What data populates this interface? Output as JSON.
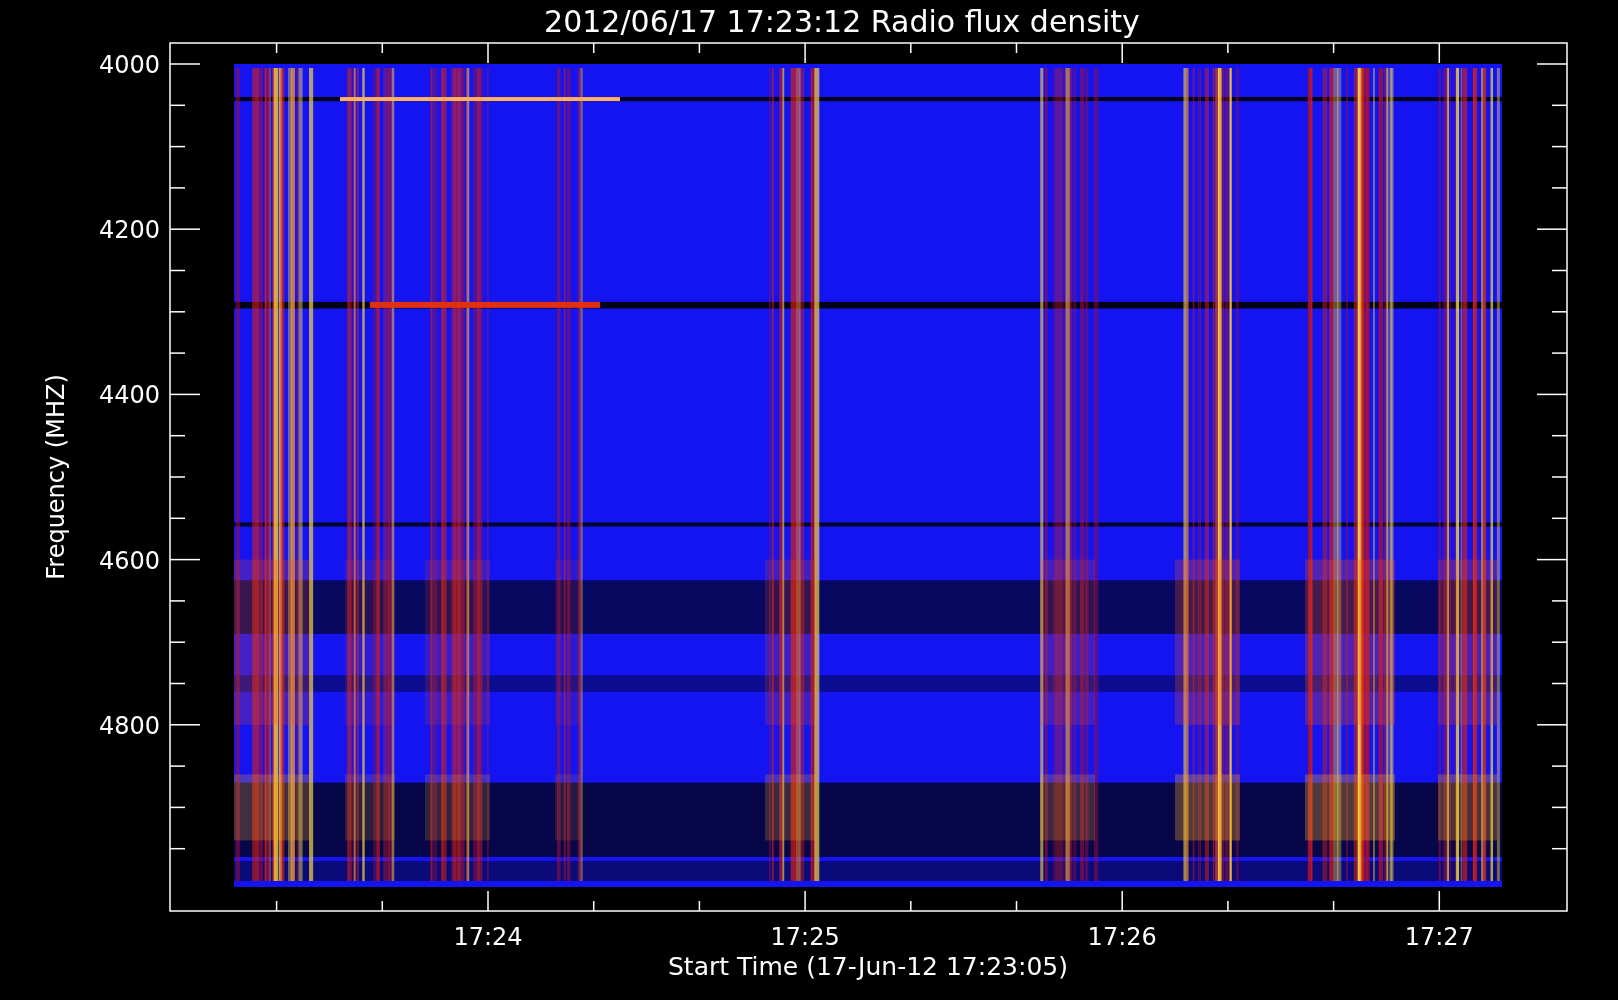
{
  "title": "2012/06/17 17:23:12 Radio flux density",
  "y_axis": {
    "label": "Frequency (MHZ)",
    "ticks": [
      "4000",
      "4200",
      "4400",
      "4600",
      "4800"
    ]
  },
  "x_axis": {
    "label": "Start Time (17-Jun-12 17:23:05)",
    "ticks": [
      "17:24",
      "17:25",
      "17:26",
      "17:27"
    ]
  }
}
